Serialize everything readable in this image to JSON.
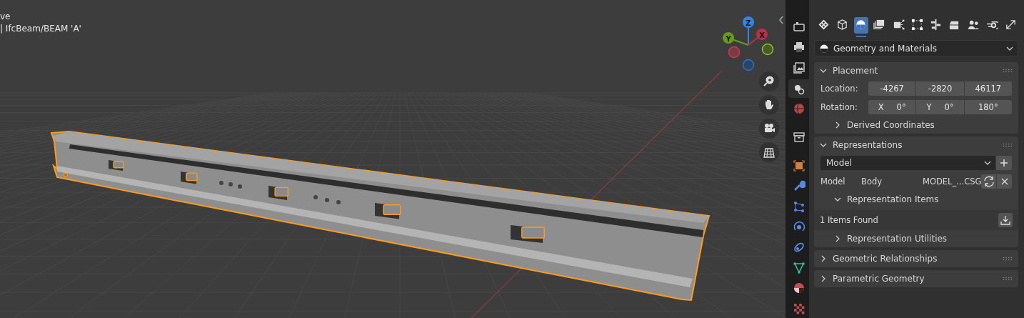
{
  "viewport": {
    "header_lines": [
      "ve",
      "| IfcBeam/BEAM 'A'"
    ],
    "gizmo_axes": [
      {
        "label": "Z"
      },
      {
        "label": "Y"
      },
      {
        "label": "X"
      }
    ]
  },
  "side_tabs": [
    {
      "selected": false
    },
    {
      "selected": false
    },
    {
      "selected": false
    },
    {
      "selected": true
    },
    {
      "selected": false
    },
    {
      "selected": false
    },
    {
      "selected": false
    },
    {
      "selected": false
    },
    {
      "selected": false
    },
    {
      "selected": false
    },
    {
      "selected": false
    },
    {
      "selected": false
    },
    {
      "selected": false
    },
    {
      "selected": false
    }
  ],
  "property_tabs": [
    {
      "selected": false
    },
    {
      "selected": false
    },
    {
      "selected": true
    },
    {
      "selected": false
    },
    {
      "selected": false
    },
    {
      "selected": false
    },
    {
      "selected": false
    },
    {
      "selected": false
    },
    {
      "selected": false
    },
    {
      "selected": false
    },
    {
      "selected": false
    }
  ],
  "mode_dropdown": {
    "value": "Geometry and Materials"
  },
  "placement": {
    "title": "Placement",
    "expanded": true,
    "location": {
      "label": "Location:",
      "values": [
        "-4267",
        "-2820",
        "46117"
      ]
    },
    "rotation": {
      "label": "Rotation:",
      "fields": [
        {
          "axis": "X",
          "value": "0°"
        },
        {
          "axis": "Y",
          "value": "0°"
        },
        {
          "value": "180°"
        }
      ]
    },
    "subpanel": {
      "title": "Derived Coordinates",
      "expanded": false
    }
  },
  "representations": {
    "title": "Representations",
    "expanded": true,
    "selector": {
      "value": "Model"
    },
    "entry": {
      "cells": [
        "Model",
        "Body",
        "MODEL_...CSG"
      ]
    },
    "items_subpanel": {
      "title": "Representation Items",
      "expanded": true,
      "count_text": "1 Items Found"
    },
    "utilities_subpanel": {
      "title": "Representation Utilities",
      "expanded": false
    }
  },
  "collapsed_panels": [
    {
      "title": "Geometric Relationships",
      "expanded": false
    },
    {
      "title": "Parametric Geometry",
      "expanded": false
    }
  ]
}
